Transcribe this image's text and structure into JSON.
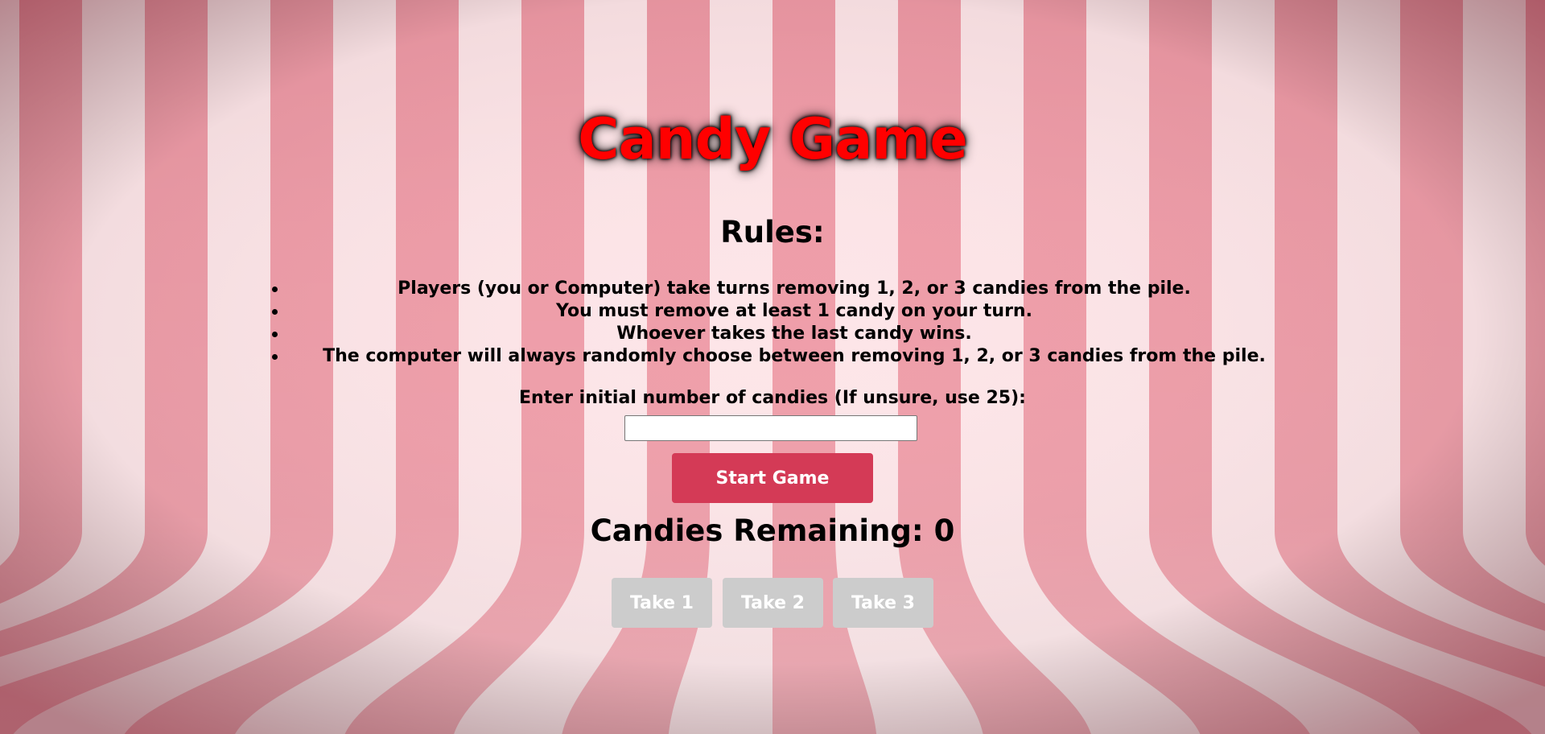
{
  "game": {
    "title": "Candy Game"
  },
  "rules": {
    "heading": "Rules:",
    "items": [
      "Players (you or Computer) take turns removing 1, 2, or 3 candies from the pile.",
      "You must remove at least 1 candy on your turn.",
      "Whoever takes the last candy wins.",
      "The computer will always randomly choose between removing 1, 2, or 3 candies from the pile."
    ]
  },
  "setup": {
    "input_label": "Enter initial number of candies (If unsure, use 25):",
    "input_value": "",
    "start_label": "Start Game"
  },
  "status": {
    "remaining_text": "Candies Remaining: 0"
  },
  "controls": {
    "take_1": "Take 1",
    "take_2": "Take 2",
    "take_3": "Take 3"
  },
  "colors": {
    "title": "#ff0000",
    "start_button": "#d43a56",
    "disabled_button": "#cccccc",
    "stripe_dark": "#e8808f",
    "stripe_light": "#fde4e7"
  }
}
